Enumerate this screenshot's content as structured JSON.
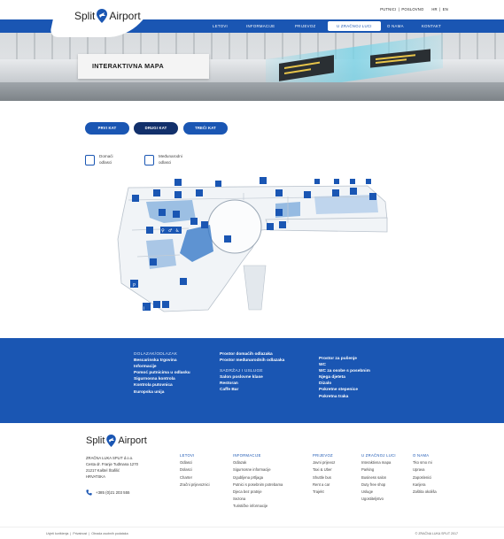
{
  "header": {
    "lang_links": [
      "PUTNICI",
      "POSLOVNO",
      "HR",
      "EN"
    ],
    "logo_text_left": "Split",
    "logo_text_right": "Airport"
  },
  "nav": {
    "items": [
      "LETOVI",
      "INFORMACIJE",
      "PRIJEVOZ",
      "U ZRAČNOJ LUCI",
      "O NAMA",
      "KONTAKT"
    ],
    "active": "U ZRAČNOJ LUCI"
  },
  "hero": {
    "title": "INTERAKTIVNA MAPA"
  },
  "floors": [
    {
      "label": "PRVI KAT",
      "active": false
    },
    {
      "label": "DRUGI KAT",
      "active": true
    },
    {
      "label": "TREĆI KAT",
      "active": false
    }
  ],
  "legend": [
    {
      "line1": "Domaći",
      "line2": "odlasci"
    },
    {
      "line1": "Međunarodni",
      "line2": "odlasci"
    }
  ],
  "band": {
    "col1": {
      "heading": "DOLAZAK/ODLAZAK",
      "items": [
        "Bescarinska trgovina",
        "Informacije",
        "Pomoć putnicima u odlasku",
        "Sigurnosna kontrola",
        "Kontrola putovnica",
        "Europska unija"
      ]
    },
    "col2": {
      "items_top": [
        "Prostor domaćih odlazaka",
        "Prostor međunarodnih odlazaka"
      ],
      "heading": "SADRŽAJ I USLUGE",
      "items": [
        "Salon poslovne klase",
        "Restoran",
        "Caffe Bar"
      ]
    },
    "col3": {
      "items": [
        "Prostor za pušenje",
        "WC",
        "WC za osobe s posebnim",
        "Njega djeteta",
        "Dizalo",
        "Pokretne stepenice",
        "Pokretna traka"
      ]
    }
  },
  "footer": {
    "logo_left": "Split",
    "logo_right": "Airport",
    "address": [
      "ZRAČNA LUKA SPLIT d.o.o.",
      "Cesta dr. Franje Tuđmana 1270",
      "21217 Kaštel Štafilić",
      "HRVATSKA"
    ],
    "phone": "+385 (0)21 203 555",
    "cols": [
      {
        "heading": "LETOVI",
        "items": [
          "Odlasci",
          "Dolasci",
          "Charter",
          "Zračni prijevoznici"
        ]
      },
      {
        "heading": "INFORMACIJE",
        "items": [
          "Odlazak",
          "Sigurnosne informacije",
          "Izgubljena prtljaga",
          "Putnici s posebnim potrebama",
          "Djeca bez pratnje",
          "Sezona",
          "Turističke informacije"
        ]
      },
      {
        "heading": "PRIJEVOZ",
        "items": [
          "Javni prijevoz",
          "Taxi & Uber",
          "Shuttle bus",
          "Rent a car",
          "Trajekt"
        ]
      },
      {
        "heading": "U ZRAČNOJ LUCI",
        "items": [
          "Interaktivna mapa",
          "Parking",
          "Business salon",
          "Duty free shop",
          "Usluge",
          "Ugostiteljstvo"
        ]
      },
      {
        "heading": "O NAMA",
        "items": [
          "Tko smo mi",
          "Uprava",
          "Zaposlenici",
          "Karijera",
          "Zaštita okoliša"
        ]
      }
    ]
  },
  "bottom": {
    "left": [
      "Uvjeti korištenja",
      "Privatnost",
      "Obrada osobnih podataka"
    ],
    "right": "© ZRAČNA LUKA SPLIT 2017"
  },
  "colors": {
    "brand_blue": "#1a56b3",
    "dark_blue": "#12306b"
  }
}
